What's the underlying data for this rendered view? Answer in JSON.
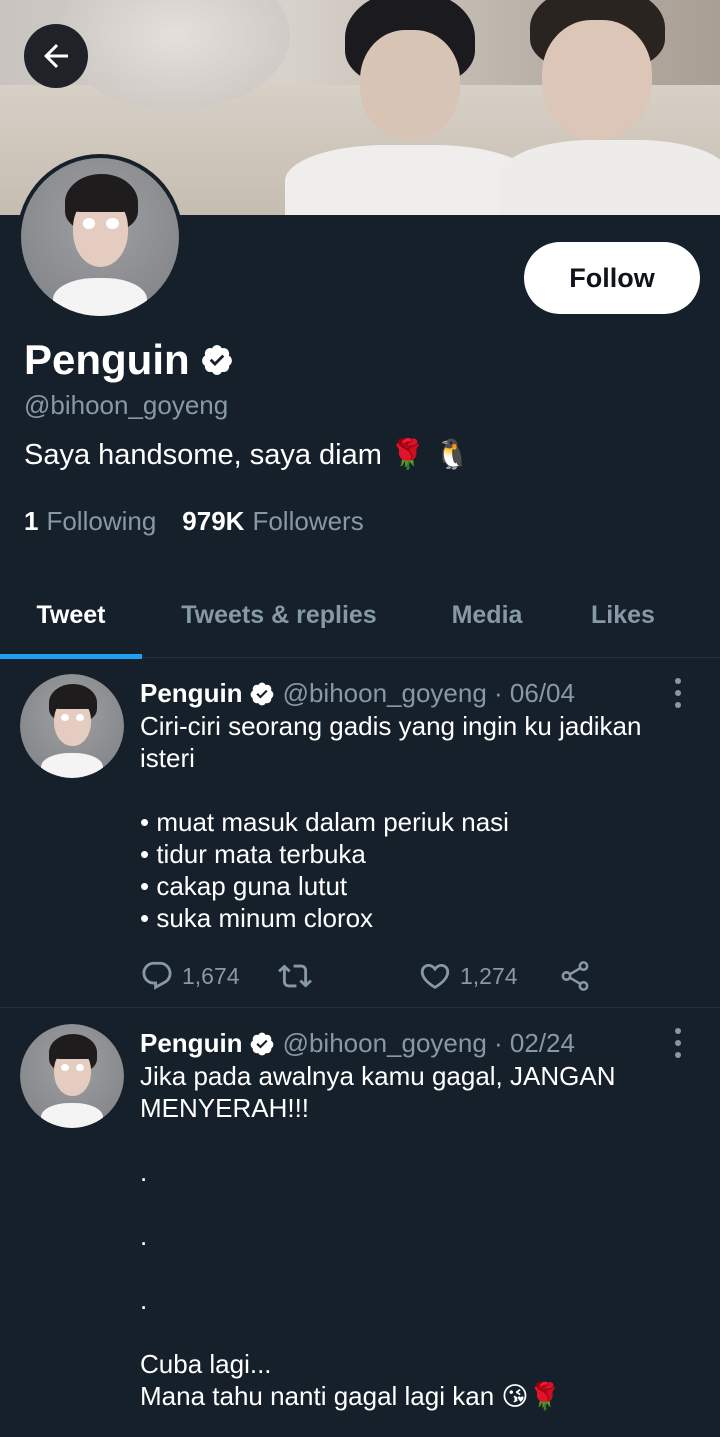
{
  "profile": {
    "display_name": "Penguin",
    "handle": "@bihoon_goyeng",
    "bio": "Saya handsome, saya diam 🌹 🐧",
    "following_count": "1",
    "following_label": "Following",
    "followers_count": "979K",
    "followers_label": "Followers",
    "follow_label": "Follow"
  },
  "tabs": [
    {
      "label": "Tweet",
      "active": true
    },
    {
      "label": "Tweets & replies",
      "active": false
    },
    {
      "label": "Media",
      "active": false
    },
    {
      "label": "Likes",
      "active": false
    }
  ],
  "tweets": [
    {
      "name": "Penguin",
      "handle": "@bihoon_goyeng · 06/04",
      "text": "Ciri-ciri seorang gadis yang ingin ku jadikan isteri\n\n• muat masuk dalam periuk nasi\n• tidur mata terbuka\n• cakap guna lutut\n• suka minum clorox",
      "replies": "1,674",
      "likes": "1,274"
    },
    {
      "name": "Penguin",
      "handle": "@bihoon_goyeng · 02/24",
      "text": "Jika pada awalnya kamu gagal, JANGAN MENYERAH!!!\n\n.\n\n.\n\n.\n\nCuba lagi...\nMana tahu nanti gagal lagi kan 😘🌹"
    }
  ],
  "icons": {
    "back": "arrow-left-icon",
    "verified": "verified-badge-icon",
    "more": "more-vertical-icon",
    "reply": "reply-icon",
    "retweet": "retweet-icon",
    "like": "heart-icon",
    "share": "share-icon"
  },
  "colors": {
    "background": "#15202b",
    "accent": "#1da1f2",
    "secondary_text": "#8899a6"
  }
}
